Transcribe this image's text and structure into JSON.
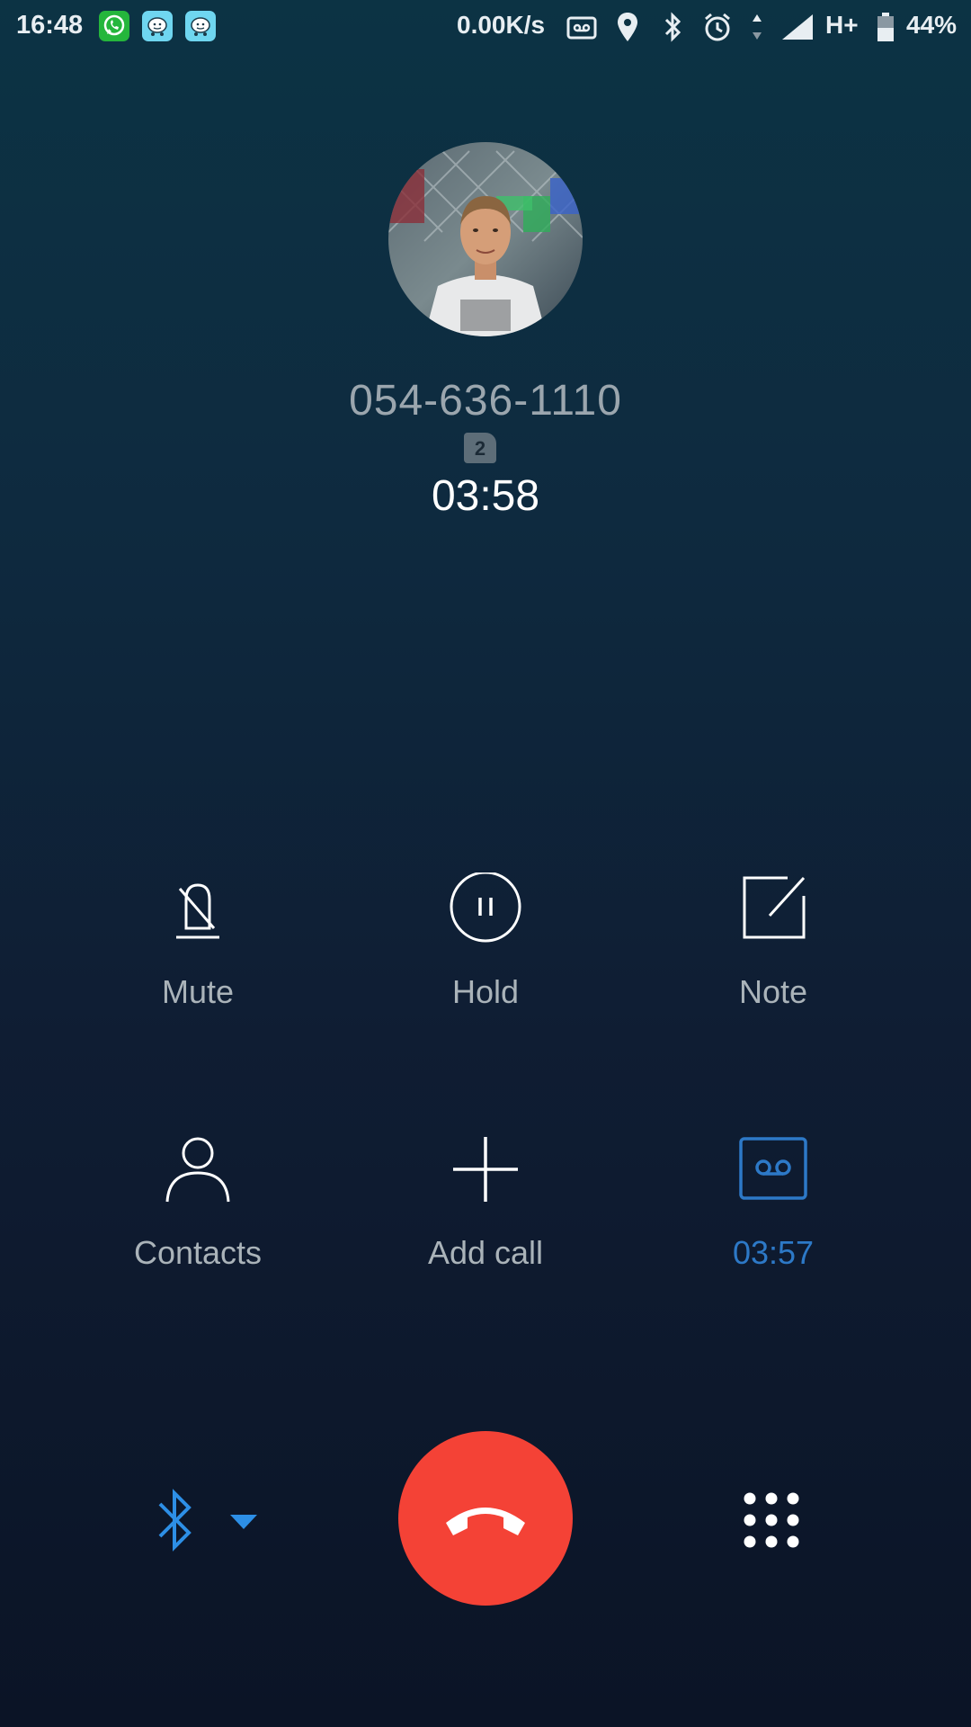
{
  "status_bar": {
    "time": "16:48",
    "apps": [
      "whatsapp-icon",
      "waze-icon",
      "waze-icon"
    ],
    "net_speed": "0.00K/s",
    "icons": [
      "voicemail-icon",
      "location-icon",
      "bluetooth-icon",
      "alarm-icon",
      "data-arrows-icon",
      "signal-icon"
    ],
    "network_type": "H+",
    "battery": "44%"
  },
  "call": {
    "number": "054-636-1110",
    "sim_slot": "2",
    "duration": "03:58"
  },
  "controls": {
    "mute_label": "Mute",
    "hold_label": "Hold",
    "note_label": "Note",
    "contacts_label": "Contacts",
    "add_call_label": "Add call",
    "recording_time": "03:57"
  },
  "bottom": {
    "audio_route": "bluetooth-icon",
    "end_call": "end-call-icon",
    "dialpad": "dialpad-icon"
  },
  "colors": {
    "accent_blue": "#2d79c7",
    "end_call_red": "#f44236",
    "label_gray": "#aab3b9"
  }
}
